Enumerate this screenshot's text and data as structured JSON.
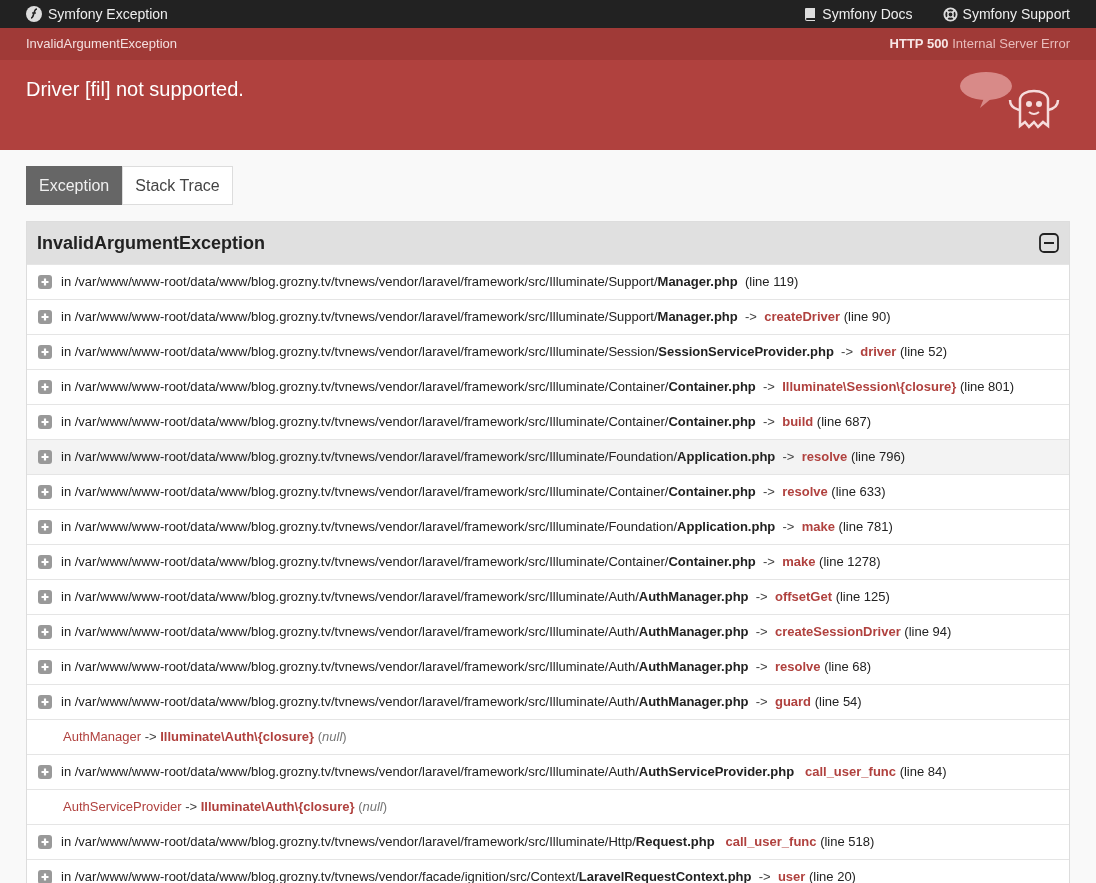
{
  "topbar": {
    "title": "Symfony Exception",
    "links": [
      {
        "kind": "docs",
        "label": "Symfony Docs"
      },
      {
        "kind": "support",
        "label": "Symfony Support"
      }
    ]
  },
  "error_bar": {
    "exception": "InvalidArgumentException",
    "status": "HTTP 500",
    "status_text": "Internal Server Error"
  },
  "message": "Driver [fil] not supported.",
  "tabs": [
    {
      "label": "Exception",
      "selected": true
    },
    {
      "label": "Stack Trace",
      "selected": false
    }
  ],
  "panel": {
    "title": "InvalidArgumentException",
    "expanded": true,
    "frames": [
      {
        "kind": "file",
        "prefix": "in",
        "path": "/var/www/www-root/data/www/blog.grozny.tv/tvnews/vendor/laravel/framework/src/Illuminate/Support/",
        "file": "Manager.php",
        "line": "(line 119)",
        "highlighted": false
      },
      {
        "kind": "file",
        "prefix": "in",
        "path": "/var/www/www-root/data/www/blog.grozny.tv/tvnews/vendor/laravel/framework/src/Illuminate/Support/",
        "file": "Manager.php",
        "arrow": "->",
        "function": "createDriver",
        "line": "(line 90)",
        "highlighted": false
      },
      {
        "kind": "file",
        "prefix": "in",
        "path": "/var/www/www-root/data/www/blog.grozny.tv/tvnews/vendor/laravel/framework/src/Illuminate/Session/",
        "file": "SessionServiceProvider.php",
        "arrow": "->",
        "function": "driver",
        "line": "(line 52)",
        "highlighted": false
      },
      {
        "kind": "file",
        "prefix": "in",
        "path": "/var/www/www-root/data/www/blog.grozny.tv/tvnews/vendor/laravel/framework/src/Illuminate/Container/",
        "file": "Container.php",
        "arrow": "->",
        "function": "Illuminate\\Session\\{closure}",
        "line": "(line 801)",
        "highlighted": false
      },
      {
        "kind": "file",
        "prefix": "in",
        "path": "/var/www/www-root/data/www/blog.grozny.tv/tvnews/vendor/laravel/framework/src/Illuminate/Container/",
        "file": "Container.php",
        "arrow": "->",
        "function": "build",
        "line": "(line 687)",
        "highlighted": false
      },
      {
        "kind": "file",
        "prefix": "in",
        "path": "/var/www/www-root/data/www/blog.grozny.tv/tvnews/vendor/laravel/framework/src/Illuminate/Foundation/",
        "file": "Application.php",
        "arrow": "->",
        "function": "resolve",
        "line": "(line 796)",
        "highlighted": true
      },
      {
        "kind": "file",
        "prefix": "in",
        "path": "/var/www/www-root/data/www/blog.grozny.tv/tvnews/vendor/laravel/framework/src/Illuminate/Container/",
        "file": "Container.php",
        "arrow": "->",
        "function": "resolve",
        "line": "(line 633)",
        "highlighted": false
      },
      {
        "kind": "file",
        "prefix": "in",
        "path": "/var/www/www-root/data/www/blog.grozny.tv/tvnews/vendor/laravel/framework/src/Illuminate/Foundation/",
        "file": "Application.php",
        "arrow": "->",
        "function": "make",
        "line": "(line 781)",
        "highlighted": false
      },
      {
        "kind": "file",
        "prefix": "in",
        "path": "/var/www/www-root/data/www/blog.grozny.tv/tvnews/vendor/laravel/framework/src/Illuminate/Container/",
        "file": "Container.php",
        "arrow": "->",
        "function": "make",
        "line": "(line 1278)",
        "highlighted": false
      },
      {
        "kind": "file",
        "prefix": "in",
        "path": "/var/www/www-root/data/www/blog.grozny.tv/tvnews/vendor/laravel/framework/src/Illuminate/Auth/",
        "file": "AuthManager.php",
        "arrow": "->",
        "function": "offsetGet",
        "line": "(line 125)",
        "highlighted": false
      },
      {
        "kind": "file",
        "prefix": "in",
        "path": "/var/www/www-root/data/www/blog.grozny.tv/tvnews/vendor/laravel/framework/src/Illuminate/Auth/",
        "file": "AuthManager.php",
        "arrow": "->",
        "function": "createSessionDriver",
        "line": "(line 94)",
        "highlighted": false
      },
      {
        "kind": "file",
        "prefix": "in",
        "path": "/var/www/www-root/data/www/blog.grozny.tv/tvnews/vendor/laravel/framework/src/Illuminate/Auth/",
        "file": "AuthManager.php",
        "arrow": "->",
        "function": "resolve",
        "line": "(line 68)",
        "highlighted": false
      },
      {
        "kind": "file",
        "prefix": "in",
        "path": "/var/www/www-root/data/www/blog.grozny.tv/tvnews/vendor/laravel/framework/src/Illuminate/Auth/",
        "file": "AuthManager.php",
        "arrow": "->",
        "function": "guard",
        "line": "(line 54)",
        "highlighted": false
      },
      {
        "kind": "call",
        "class": "AuthManager",
        "arrow": "->",
        "function": "Illuminate\\Auth\\{closure}",
        "args": "(*null*)"
      },
      {
        "kind": "file",
        "prefix": "in",
        "path": "/var/www/www-root/data/www/blog.grozny.tv/tvnews/vendor/laravel/framework/src/Illuminate/Auth/",
        "file": "AuthServiceProvider.php",
        "function": "call_user_func",
        "line": "(line 84)",
        "highlighted": false
      },
      {
        "kind": "call",
        "class": "AuthServiceProvider",
        "arrow": "->",
        "function": "Illuminate\\Auth\\{closure}",
        "args": "(*null*)"
      },
      {
        "kind": "file",
        "prefix": "in",
        "path": "/var/www/www-root/data/www/blog.grozny.tv/tvnews/vendor/laravel/framework/src/Illuminate/Http/",
        "file": "Request.php",
        "function": "call_user_func",
        "line": "(line 518)",
        "highlighted": false
      },
      {
        "kind": "file",
        "prefix": "in",
        "path": "/var/www/www-root/data/www/blog.grozny.tv/tvnews/vendor/facade/ignition/src/Context/",
        "file": "LaravelRequestContext.php",
        "arrow": "->",
        "function": "user",
        "line": "(line 20)",
        "highlighted": false
      }
    ]
  }
}
